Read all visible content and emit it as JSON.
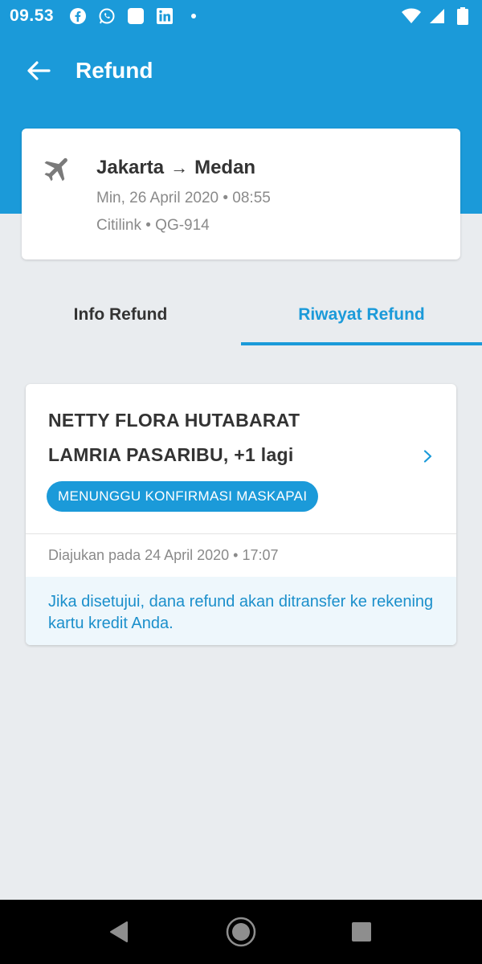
{
  "status_bar": {
    "time": "09.53",
    "left_icons": [
      "facebook-icon",
      "whatsapp-icon",
      "app-icon",
      "linkedin-icon",
      "dot-icon"
    ],
    "right_icons": [
      "wifi-icon",
      "signal-icon",
      "battery-icon"
    ]
  },
  "app_bar": {
    "title": "Refund"
  },
  "flight": {
    "origin": "Jakarta",
    "arrow": "→",
    "destination": "Medan",
    "date": "Min, 26 April 2020 • 08:55",
    "airline": "Citilink • QG-914"
  },
  "tabs": [
    {
      "label": "Info Refund",
      "active": false
    },
    {
      "label": "Riwayat Refund",
      "active": true
    }
  ],
  "refund_card": {
    "passenger_line_1": "NETTY FLORA HUTABARAT",
    "passenger_line_2": "LAMRIA PASARIBU, +1 lagi",
    "status": "MENUNGGU KONFIRMASI MASKAPAI",
    "submitted": "Diajukan pada 24 April 2020 • 17:07",
    "info": "Jika disetujui, dana refund akan ditransfer ke rekening kartu kredit Anda."
  },
  "colors": {
    "primary": "#1B9AD9",
    "background": "#E9ECEF",
    "text_dark": "#333333",
    "text_muted": "#8A8A8A",
    "info_bg": "#EEF7FC"
  }
}
